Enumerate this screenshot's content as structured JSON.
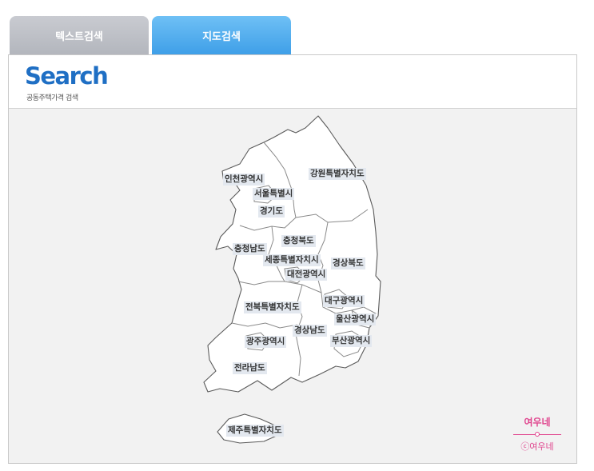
{
  "tabs": {
    "text_search": "텍스트검색",
    "map_search": "지도검색"
  },
  "header": {
    "title": "Search",
    "subtitle": "공동주택가격 검색"
  },
  "regions": {
    "incheon": "인천광역시",
    "seoul": "서울특별시",
    "gyeonggi": "경기도",
    "gangwon": "강원특별자치도",
    "chungnam": "충청남도",
    "chungbuk": "충청북도",
    "sejong": "세종특별자치시",
    "daejeon": "대전광역시",
    "gyeongbuk": "경상북도",
    "jeonbuk": "전북특별자치도",
    "daegu": "대구광역시",
    "ulsan": "울산광역시",
    "gyeongnam": "경상남도",
    "gwangju": "광주광역시",
    "busan": "부산광역시",
    "jeonnam": "전라남도",
    "jeju": "제주특별자치도"
  },
  "brand": {
    "name": "여우네",
    "copyright": "ⓒ여우네",
    "color": "#e0458e"
  },
  "colors": {
    "tab_active": "#4aa8ee",
    "tab_inactive": "#bfc2c8",
    "title": "#1f6fc4"
  }
}
